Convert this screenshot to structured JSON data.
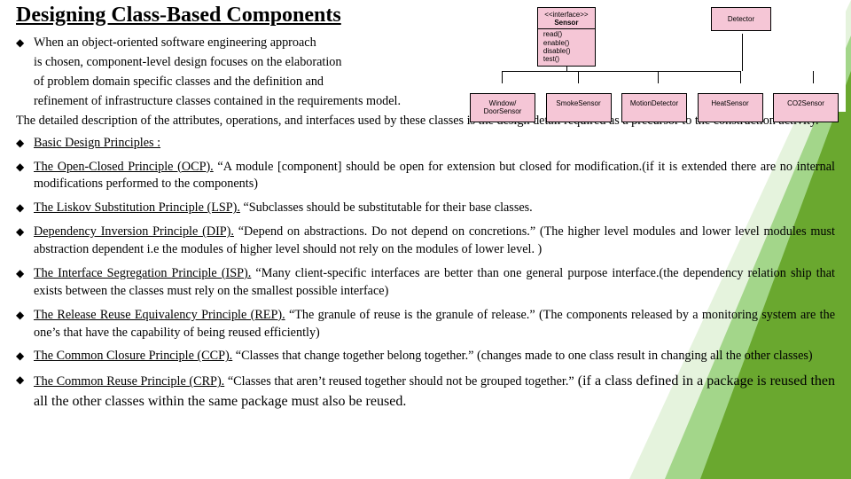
{
  "title": "Designing Class-Based Components",
  "intro": {
    "l1": "When an object-oriented software engineering approach",
    "l2": "is chosen, component-level design focuses on the elaboration",
    "l3": "of problem domain specific classes and the definition and",
    "l4": " refinement of infrastructure classes contained in the requirements model."
  },
  "para": "The detailed description of the attributes, operations, and interfaces used by these classes is the design detail required as a precursor to the construction activity.",
  "principles_heading": "Basic Design Principles :",
  "principles": [
    {
      "lead": "The Open-Closed Principle (OCP).",
      "rest": " “A module [component] should be open for extension but closed for modification.(if it is extended there are no internal modifications performed to the components)"
    },
    {
      "lead": "The Liskov Substitution Principle (LSP).",
      "rest": " “Subclasses should be substitutable for their base classes."
    },
    {
      "lead": "Dependency Inversion Principle (DIP).",
      "rest": " “Depend on abstractions. Do not depend on concretions.” (The higher level modules and lower level modules must abstraction dependent i.e the modules of higher level should not rely on the modules of lower level. )"
    },
    {
      "lead": "The Interface Segregation Principle (ISP).",
      "rest": " “Many client-specific interfaces are better than one general purpose interface.(the dependency relation ship that exists between the classes must rely on the smallest possible interface)"
    },
    {
      "lead": "The Release Reuse Equivalency Principle (REP).",
      "rest": " “The granule of reuse is the granule of release.” (The components released by a monitoring system are the one’s that have the capability of being reused efficiently)"
    },
    {
      "lead": "The Common Closure Principle (CCP).",
      "rest": " “Classes that change together belong together.” (changes made to one class result in changing all the other classes)"
    },
    {
      "lead": "The Common Reuse Principle (CRP).",
      "rest": " “Classes that aren’t reused together should not be grouped together.”",
      "tail": " (if a class defined in a package is reused then all the other classes within the same package must also be reused."
    }
  ],
  "diagram": {
    "sensor": {
      "stereo": "<<interface>>",
      "name": "Sensor",
      "ops": [
        "read()",
        "enable()",
        "disable()",
        "test()"
      ]
    },
    "detector": "Detector",
    "row2": [
      "Window/\nDoorSensor",
      "SmokeSensor",
      "MotionDetector",
      "HeatSensor",
      "CO2Sensor"
    ]
  }
}
